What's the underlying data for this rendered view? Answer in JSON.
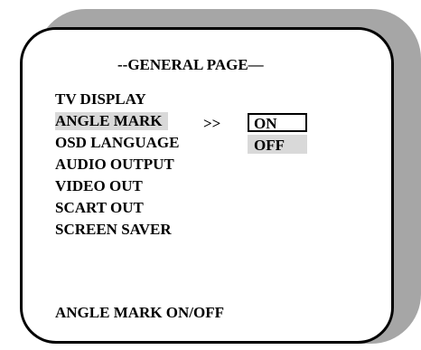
{
  "page_title": "--GENERAL PAGE—",
  "menu": {
    "items": [
      {
        "label": "TV DISPLAY"
      },
      {
        "label": "ANGLE MARK"
      },
      {
        "label": "OSD LANGUAGE"
      },
      {
        "label": "AUDIO OUTPUT"
      },
      {
        "label": "VIDEO OUT"
      },
      {
        "label": "SCART OUT"
      },
      {
        "label": "SCREEN SAVER"
      }
    ],
    "selected_index": 1
  },
  "submenu": {
    "arrow": ">>",
    "options": [
      {
        "label": "ON"
      },
      {
        "label": "OFF"
      }
    ]
  },
  "help_text": "ANGLE MARK ON/OFF",
  "colors": {
    "highlight": "#d9d9d9",
    "shadow": "#a6a6a6",
    "border": "#000000"
  }
}
